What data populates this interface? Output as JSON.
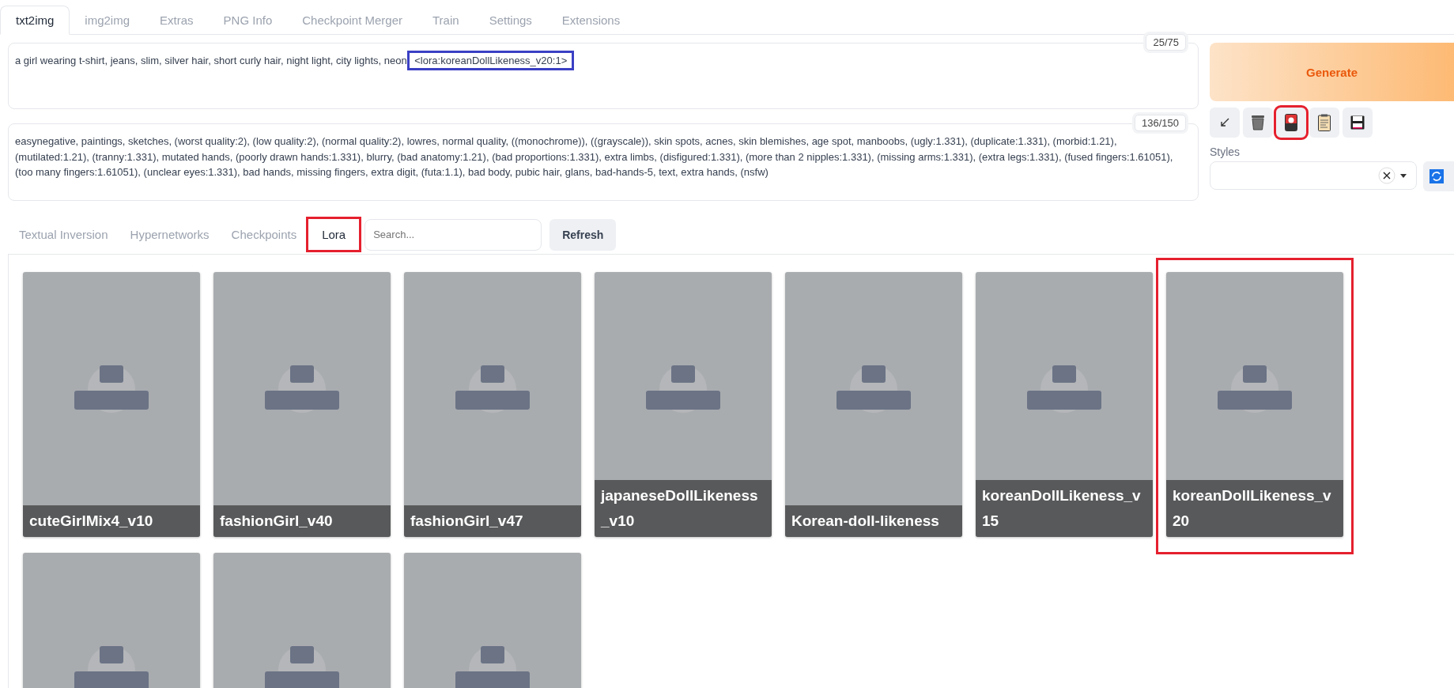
{
  "tabs": [
    {
      "label": "txt2img",
      "selected": true
    },
    {
      "label": "img2img",
      "selected": false
    },
    {
      "label": "Extras",
      "selected": false
    },
    {
      "label": "PNG Info",
      "selected": false
    },
    {
      "label": "Checkpoint Merger",
      "selected": false
    },
    {
      "label": "Train",
      "selected": false
    },
    {
      "label": "Settings",
      "selected": false
    },
    {
      "label": "Extensions",
      "selected": false
    }
  ],
  "prompt": {
    "text": "a girl wearing t-shirt, jeans, slim, silver hair, short curly hair, night light, city lights, neon",
    "tag": "<lora:koreanDollLikeness_v20:1>",
    "tag_annotated": true,
    "counter": "25/75"
  },
  "negative_prompt": {
    "text": "easynegative, paintings, sketches, (worst quality:2), (low quality:2), (normal quality:2), lowres, normal quality, ((monochrome)), ((grayscale)), skin spots, acnes, skin blemishes, age spot, manboobs, (ugly:1.331), (duplicate:1.331), (morbid:1.21), (mutilated:1.21), (tranny:1.331), mutated hands, (poorly drawn hands:1.331), blurry, (bad anatomy:1.21), (bad proportions:1.331), extra limbs, (disfigured:1.331), (more than 2 nipples:1.331), (missing arms:1.331), (extra legs:1.331), (fused fingers:1.61051), (too many fingers:1.61051), (unclear eyes:1.331), bad hands, missing fingers, extra digit, (futa:1.1), bad body, pubic hair, glans, bad-hands-5, text, extra hands, (nsfw)",
    "counter": "136/150"
  },
  "generate_button": "Generate",
  "tools": [
    {
      "kind": "arrow",
      "annotated": false
    },
    {
      "kind": "trash",
      "annotated": false
    },
    {
      "kind": "card",
      "annotated": true
    },
    {
      "kind": "clipboard",
      "annotated": false
    },
    {
      "kind": "save",
      "annotated": false
    }
  ],
  "styles": {
    "label": "Styles"
  },
  "network_tabs": [
    {
      "label": "Textual Inversion",
      "selected": false,
      "annotated": false
    },
    {
      "label": "Hypernetworks",
      "selected": false,
      "annotated": false
    },
    {
      "label": "Checkpoints",
      "selected": false,
      "annotated": false
    },
    {
      "label": "Lora",
      "selected": true,
      "annotated": true
    }
  ],
  "search": {
    "placeholder": "Search..."
  },
  "refresh_button": "Refresh",
  "cards": [
    {
      "name": "cuteGirlMix4_v10",
      "annotated": false
    },
    {
      "name": "fashionGirl_v40",
      "annotated": false
    },
    {
      "name": "fashionGirl_v47",
      "annotated": false
    },
    {
      "name": "japaneseDollLikeness_v10",
      "annotated": false
    },
    {
      "name": "Korean-doll-likeness",
      "annotated": false
    },
    {
      "name": "koreanDollLikeness_v15",
      "annotated": false
    },
    {
      "name": "koreanDollLikeness_v20",
      "annotated": true
    },
    {
      "annotated": false
    },
    {
      "annotated": false
    },
    {
      "annotated": false
    }
  ]
}
